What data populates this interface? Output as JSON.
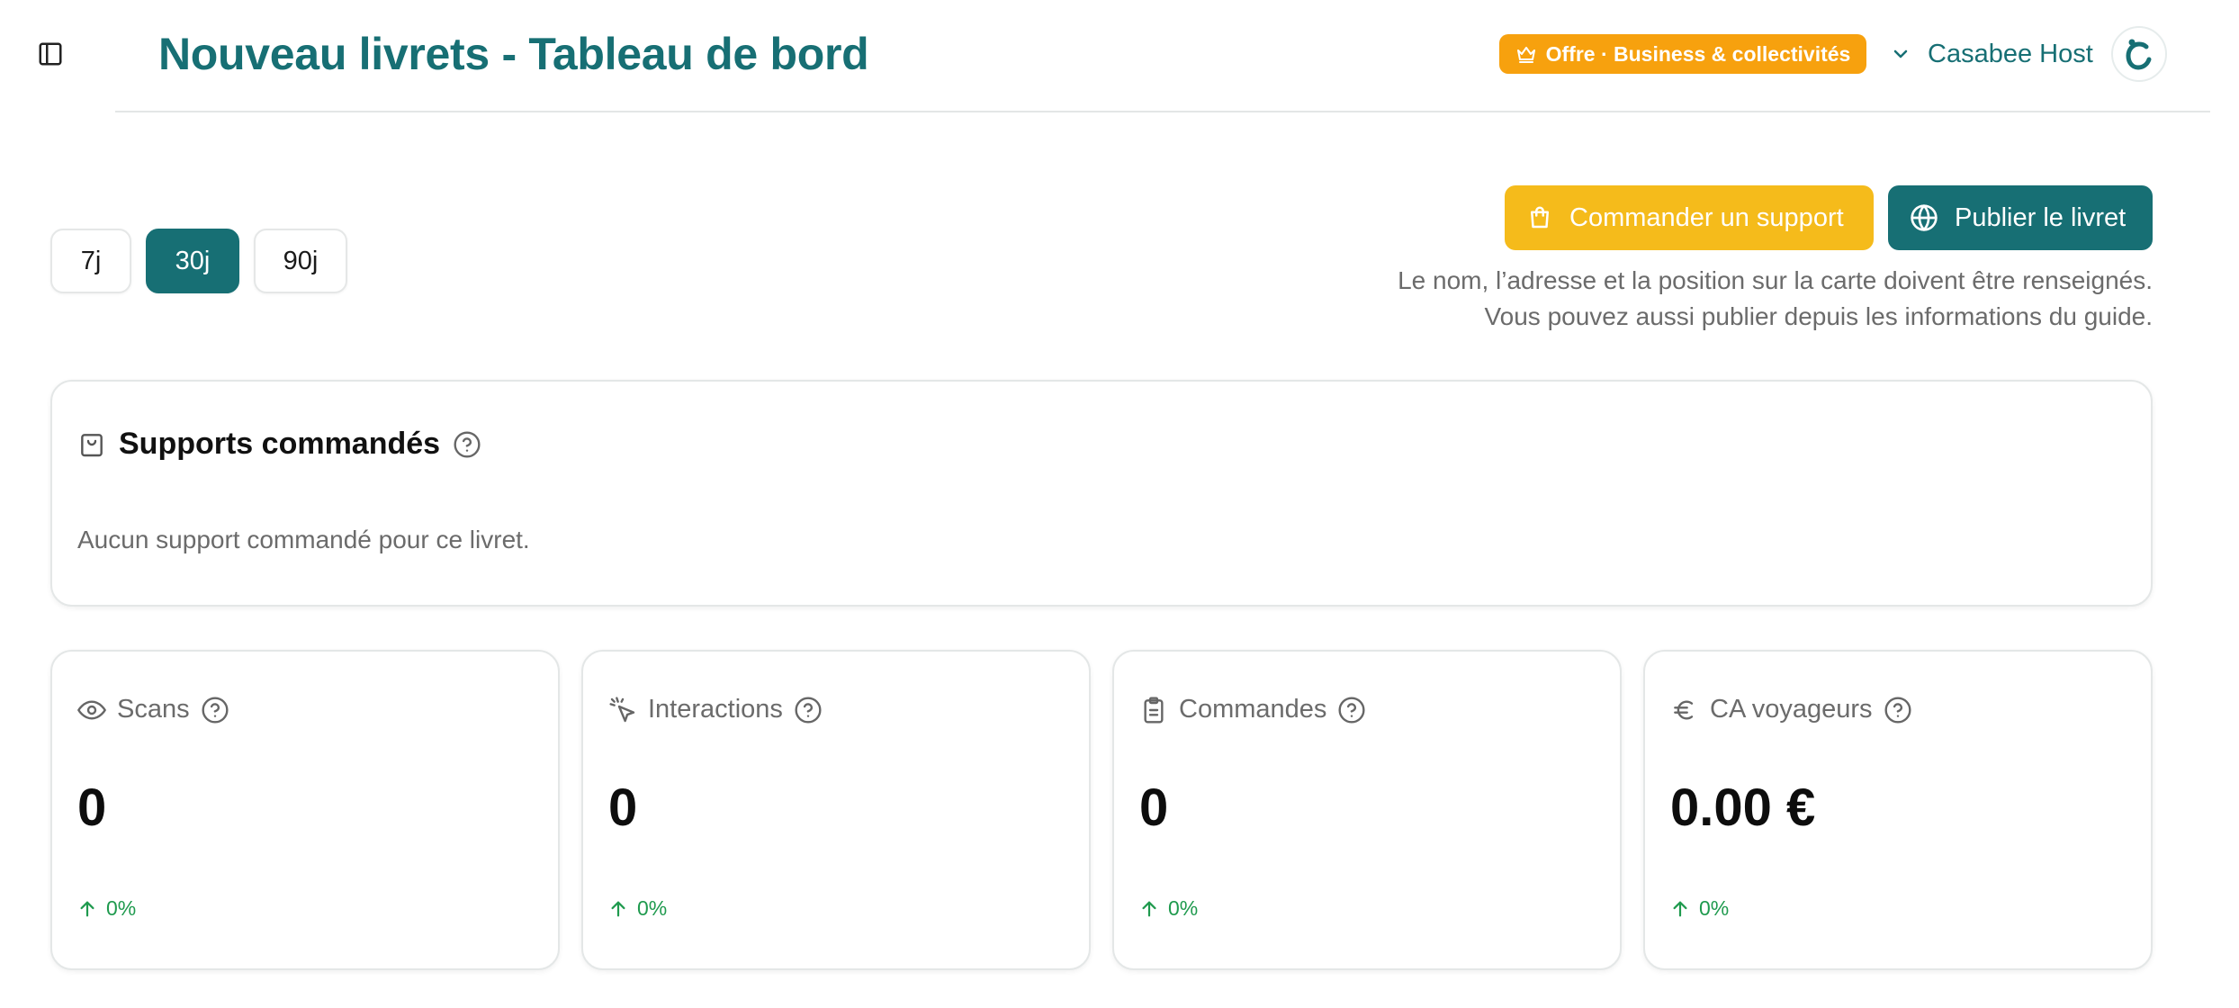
{
  "header": {
    "title": "Nouveau livrets - Tableau de bord",
    "plan_badge": "Offre · Business & collectivités",
    "account_name": "Casabee Host"
  },
  "period": {
    "options": [
      "7j",
      "30j",
      "90j"
    ],
    "selected": "30j"
  },
  "actions": {
    "order_label": "Commander un support",
    "publish_label": "Publier le livret",
    "publish_hint_line1": "Le nom, l’adresse et la position sur la carte doivent être renseignés.",
    "publish_hint_line2": "Vous pouvez aussi publier depuis les informations du guide."
  },
  "supports": {
    "title": "Supports commandés",
    "empty_text": "Aucun support commandé pour ce livret."
  },
  "metrics": [
    {
      "label": "Scans",
      "value": "0",
      "trend": "0%",
      "icon": "eye-icon"
    },
    {
      "label": "Interactions",
      "value": "0",
      "trend": "0%",
      "icon": "pointer-click-icon"
    },
    {
      "label": "Commandes",
      "value": "0",
      "trend": "0%",
      "icon": "clipboard-icon"
    },
    {
      "label": "CA voyageurs",
      "value": "0.00 €",
      "trend": "0%",
      "icon": "euro-icon"
    }
  ],
  "colors": {
    "brand_teal": "#176f74",
    "badge_orange": "#f7a10e",
    "order_yellow": "#f5bb1b",
    "trend_green": "#1f9a4e"
  }
}
